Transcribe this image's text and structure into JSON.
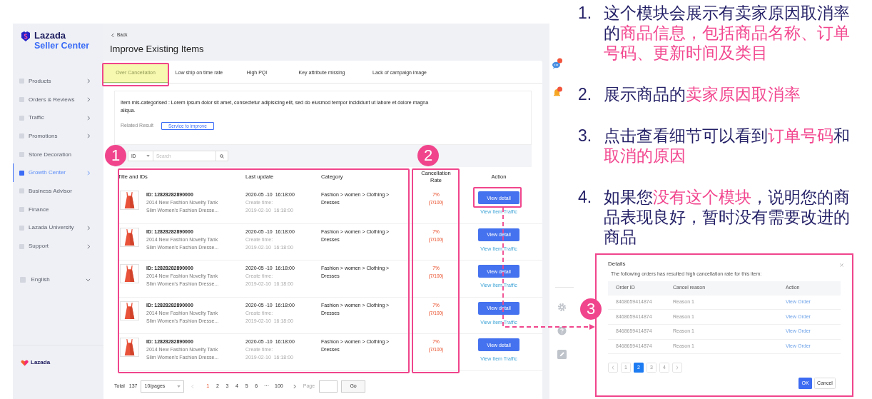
{
  "sidebar": {
    "logo": {
      "line1": "Lazada",
      "line2": "Seller Center"
    },
    "items": [
      {
        "label": "Products",
        "has_children": true,
        "selected": false
      },
      {
        "label": "Orders & Reviews",
        "has_children": true,
        "selected": false
      },
      {
        "label": "Traffic",
        "has_children": true,
        "selected": false
      },
      {
        "label": "Promotions",
        "has_children": true,
        "selected": false
      },
      {
        "label": "Store Decoration",
        "has_children": false,
        "selected": false
      },
      {
        "label": "Growth Center",
        "has_children": true,
        "selected": true
      },
      {
        "label": "Business Advisor",
        "has_children": false,
        "selected": false
      },
      {
        "label": "Finance",
        "has_children": false,
        "selected": false
      },
      {
        "label": "Lazada University",
        "has_children": true,
        "selected": false
      },
      {
        "label": "Support",
        "has_children": true,
        "selected": false
      }
    ],
    "language": "English",
    "footer_logo": "Lazada"
  },
  "page": {
    "back": "Back",
    "title": "Improve Existing Items",
    "tabs": [
      {
        "label": "Over Cancellation",
        "selected": true
      },
      {
        "label": "Low ship on time rate",
        "selected": false
      },
      {
        "label": "High PQI",
        "selected": false
      },
      {
        "label": "Key attribute missing",
        "selected": false
      },
      {
        "label": "Lack of campaign image",
        "selected": false
      }
    ],
    "notice": {
      "text": "Item mis-categorised : Lorem ipsum dolor sit amet, consectetur adipisicing elit, sed do eiusmod tempor incididunt ut labore et dolore magna aliqua.",
      "related_label": "Related Result",
      "related_button": "Service to improve"
    },
    "filter": {
      "select": "ID",
      "placeholder": "Search"
    },
    "table": {
      "columns": [
        "Title and IDs",
        "Last update",
        "Category",
        "Cancellation Rate",
        "Action"
      ],
      "rows": [
        {
          "id": "ID: 12828282890000",
          "title_1": "2014 New Fashion Novelty Tank",
          "title_2": "Slim Women's Fashion Dresse...",
          "updated": "2020-05 -10  16:18:00",
          "created_label": "Create time:",
          "created": "2019-02-10  16:18:00",
          "category": "Fashion > women > Clothing > Dresses",
          "rate": "7%",
          "rate_detail": "(7/100)",
          "button": "View detail",
          "link": "View Item Traffic"
        },
        {
          "id": "ID: 12828282890000",
          "title_1": "2014 New Fashion Novelty Tank",
          "title_2": "Slim Women's Fashion Dresse...",
          "updated": "2020-05 -10  16:18:00",
          "created_label": "Create time:",
          "created": "2019-02-10  16:18:00",
          "category": "Fashion > women > Clothing > Dresses",
          "rate": "7%",
          "rate_detail": "(7/100)",
          "button": "View detail",
          "link": "View Item Traffic"
        },
        {
          "id": "ID: 12828282890000",
          "title_1": "2014 New Fashion Novelty Tank",
          "title_2": "Slim Women's Fashion Dresse...",
          "updated": "2020-05 -10  16:18:00",
          "created_label": "Create time:",
          "created": "2019-02-10  16:18:00",
          "category": "Fashion > women > Clothing > Dresses",
          "rate": "7%",
          "rate_detail": "(7/100)",
          "button": "View detail",
          "link": "View Item Traffic"
        },
        {
          "id": "ID: 12828282890000",
          "title_1": "2014 New Fashion Novelty Tank",
          "title_2": "Slim Women's Fashion Dresse...",
          "updated": "2020-05 -10  16:18:00",
          "created_label": "Create time:",
          "created": "2019-02-10  16:18:00",
          "category": "Fashion > women > Clothing > Dresses",
          "rate": "7%",
          "rate_detail": "(7/100)",
          "button": "View detail",
          "link": "View Item Traffic"
        },
        {
          "id": "ID: 12828282890000",
          "title_1": "2014 New Fashion Novelty Tank",
          "title_2": "Slim Women's Fashion Dresse...",
          "updated": "2020-05 -10  16:18:00",
          "created_label": "Create time:",
          "created": "2019-02-10  16:18:00",
          "category": "Fashion > women > Clothing > Dresses",
          "rate": "7%",
          "rate_detail": "(7/100)",
          "button": "View detail",
          "link": "View Item Traffic"
        }
      ]
    },
    "pagination": {
      "total_label": "Total",
      "total": "137",
      "page_size": "10/pages",
      "pages": [
        {
          "label": "1",
          "selected": true
        },
        {
          "label": "2",
          "selected": false
        },
        {
          "label": "3",
          "selected": false
        },
        {
          "label": "4",
          "selected": false
        },
        {
          "label": "5",
          "selected": false
        },
        {
          "label": "6",
          "selected": false
        }
      ],
      "ellipsis": "···",
      "last": "100",
      "jump_label": "Page",
      "go": "Go"
    }
  },
  "notes": [
    {
      "number": "1.",
      "parts": [
        {
          "text": "这个模块会展示有卖家原因取消率的",
          "highlight": false
        },
        {
          "text": "商品信息，包括商品名称、订单号码、更新时间及类目",
          "highlight": true
        }
      ]
    },
    {
      "number": "2.",
      "parts": [
        {
          "text": "展示商品的",
          "highlight": false
        },
        {
          "text": "卖家原因取消率",
          "highlight": true
        }
      ]
    },
    {
      "number": "3.",
      "parts": [
        {
          "text": "点击查看细节可以看到",
          "highlight": false
        },
        {
          "text": "订单号码",
          "highlight": true
        },
        {
          "text": "和",
          "highlight": false
        },
        {
          "text": "取消的原因",
          "highlight": true
        }
      ]
    },
    {
      "number": "4.",
      "parts": [
        {
          "text": "如果您",
          "highlight": false
        },
        {
          "text": "没有这个模块",
          "highlight": true
        },
        {
          "text": "，说明您的商品表现良好，暂时没有需要改进的商品",
          "highlight": false
        }
      ]
    }
  ],
  "callouts": [
    "1",
    "2",
    "3"
  ],
  "dialog": {
    "title": "Details",
    "subtitle": "The following orders has resulted high cancellation rate for this item:",
    "columns": [
      "Order ID",
      "Cancel reason",
      "Action"
    ],
    "rows": [
      {
        "order_id": "8468659414874",
        "reason": "Reason 1",
        "action": "View Order"
      },
      {
        "order_id": "8468659414874",
        "reason": "Reason 1",
        "action": "View Order"
      },
      {
        "order_id": "8468659414874",
        "reason": "Reason 1",
        "action": "View Order"
      },
      {
        "order_id": "8468659414874",
        "reason": "Reason 1",
        "action": "View Order"
      }
    ],
    "pages": [
      {
        "label": "1",
        "selected": false
      },
      {
        "label": "2",
        "selected": true
      },
      {
        "label": "3",
        "selected": false
      },
      {
        "label": "4",
        "selected": false
      }
    ],
    "ok": "OK",
    "cancel": "Cancel"
  }
}
